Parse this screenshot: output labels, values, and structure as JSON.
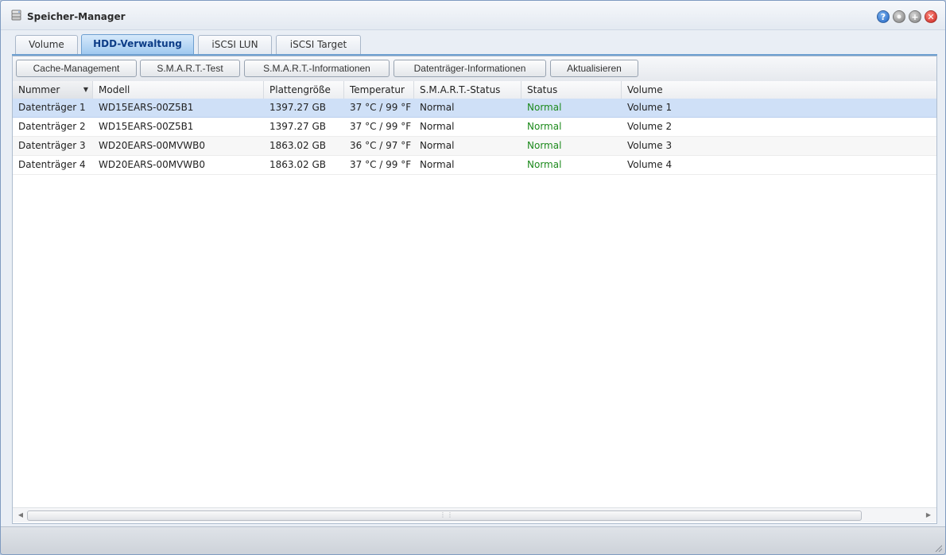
{
  "window": {
    "title": "Speicher-Manager",
    "icons": [
      "disk-stack-icon",
      "help-icon",
      "minimize-icon",
      "maximize-icon",
      "close-icon"
    ],
    "help_glyph": "?",
    "max_glyph": "+",
    "close_glyph": "✕"
  },
  "tabs": [
    {
      "label": "Volume",
      "active": false
    },
    {
      "label": "HDD-Verwaltung",
      "active": true
    },
    {
      "label": "iSCSI LUN",
      "active": false
    },
    {
      "label": "iSCSI Target",
      "active": false
    }
  ],
  "toolbar": {
    "cache_management": "Cache-Management",
    "smart_test": "S.M.A.R.T.-Test",
    "smart_info": "S.M.A.R.T.-Informationen",
    "disk_info": "Datenträger-Informationen",
    "refresh": "Aktualisieren"
  },
  "table": {
    "columns": [
      "Nummer",
      "Modell",
      "Plattengröße",
      "Temperatur",
      "S.M.A.R.T.-Status",
      "Status",
      "Volume"
    ],
    "sort_column": "Nummer",
    "rows": [
      {
        "number": "Datenträger 1",
        "model": "WD15EARS-00Z5B1",
        "size": "1397.27 GB",
        "temp": "37 °C / 99 °F",
        "smart": "Normal",
        "status": "Normal",
        "volume": "Volume 1",
        "selected": true
      },
      {
        "number": "Datenträger 2",
        "model": "WD15EARS-00Z5B1",
        "size": "1397.27 GB",
        "temp": "37 °C / 99 °F",
        "smart": "Normal",
        "status": "Normal",
        "volume": "Volume 2",
        "selected": false
      },
      {
        "number": "Datenträger 3",
        "model": "WD20EARS-00MVWB0",
        "size": "1863.02 GB",
        "temp": "36 °C / 97 °F",
        "smart": "Normal",
        "status": "Normal",
        "volume": "Volume 3",
        "selected": false
      },
      {
        "number": "Datenträger 4",
        "model": "WD20EARS-00MVWB0",
        "size": "1863.02 GB",
        "temp": "37 °C / 99 °F",
        "smart": "Normal",
        "status": "Normal",
        "volume": "Volume 4",
        "selected": false
      }
    ]
  },
  "colors": {
    "status_ok": "#1d8a1d",
    "selected_row": "#cfe0f7",
    "active_tab": "#9ec8ef"
  }
}
